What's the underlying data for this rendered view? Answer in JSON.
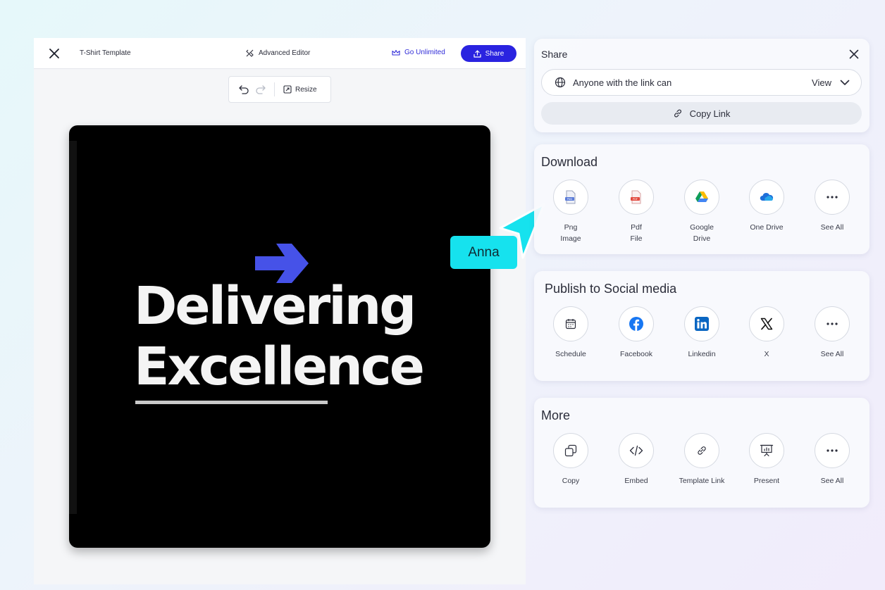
{
  "editor": {
    "template_name": "T-Shirt Template",
    "advanced_editor": "Advanced Editor",
    "go_unlimited": "Go Unlimited",
    "share_button": "Share",
    "resize": "Resize"
  },
  "canvas": {
    "headline_line1": "Delivering",
    "headline_line2": "Excellence",
    "arrow_color": "#4652e8"
  },
  "collaborator": {
    "name": "Anna",
    "color": "#16e2ee"
  },
  "share_panel": {
    "title": "Share",
    "access_text": "Anyone with the link can",
    "access_value": "View",
    "copy_link": "Copy Link"
  },
  "download": {
    "title": "Download",
    "items": [
      {
        "line1": "Png",
        "line2": "Image",
        "icon": "png-file-icon"
      },
      {
        "line1": "Pdf",
        "line2": "File",
        "icon": "pdf-file-icon"
      },
      {
        "line1": "Google",
        "line2": "Drive",
        "icon": "google-drive-icon"
      },
      {
        "line1": "One Drive",
        "line2": "",
        "icon": "onedrive-icon"
      },
      {
        "line1": "See All",
        "line2": "",
        "icon": "more-dots-icon"
      }
    ]
  },
  "social": {
    "title": "Publish to Social media",
    "items": [
      {
        "label": "Schedule",
        "icon": "calendar-icon"
      },
      {
        "label": "Facebook",
        "icon": "facebook-icon"
      },
      {
        "label": "Linkedin",
        "icon": "linkedin-icon"
      },
      {
        "label": "X",
        "icon": "x-logo-icon"
      },
      {
        "label": "See All",
        "icon": "more-dots-icon"
      }
    ]
  },
  "more": {
    "title": "More",
    "items": [
      {
        "label": "Copy",
        "icon": "copy-icon"
      },
      {
        "label": "Embed",
        "icon": "embed-code-icon"
      },
      {
        "label": "Template Link",
        "icon": "link-icon"
      },
      {
        "label": "Present",
        "icon": "presentation-icon"
      },
      {
        "label": "See All",
        "icon": "more-dots-icon"
      }
    ]
  },
  "colors": {
    "primary": "#2a23e0",
    "facebook": "#1877f2",
    "linkedin": "#0a66c2"
  }
}
